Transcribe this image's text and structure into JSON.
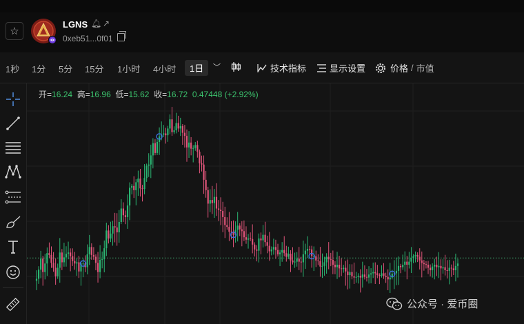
{
  "header": {
    "token_name": "LGNS",
    "address": "0xeb51...0f01",
    "favorite_icon": "star-icon",
    "bell_icon": "bell-icon",
    "external_icon": "external-link-icon",
    "copy_icon": "copy-icon"
  },
  "toolbar": {
    "timeframes": [
      "1秒",
      "1分",
      "5分",
      "15分",
      "1小时",
      "4小时"
    ],
    "active_timeframe": "1日",
    "chart_type_icon": "candlestick-icon",
    "indicators_label": "技术指标",
    "display_label": "显示设置",
    "price_label": "价格",
    "slash": "/",
    "marketcap_label": "市值"
  },
  "left_tools": [
    "crosshair-icon",
    "trend-line-icon",
    "horizontal-lines-icon",
    "pattern-icon",
    "fib-icon",
    "brush-icon",
    "text-icon",
    "emoji-icon",
    "ruler-icon"
  ],
  "ohlc": {
    "open_label": "开=",
    "open": "16.24",
    "high_label": "高=",
    "high": "16.96",
    "low_label": "低=",
    "low": "15.62",
    "close_label": "收=",
    "close": "16.72",
    "change": "0.47448 (+2.92%)"
  },
  "colors": {
    "up": "#2bb673",
    "down": "#e0557a",
    "background": "#141414"
  },
  "watermark": "公众号 · 爱币圈",
  "chart_data": {
    "type": "candlestick",
    "title": "",
    "close": [
      6.5,
      8,
      9.8,
      7.6,
      9,
      10.7,
      10.4,
      9.1,
      8.3,
      6.9,
      8.3,
      10.8,
      9.2,
      10,
      10.6,
      10.8,
      10.2,
      9.4,
      9,
      9.2,
      7.7,
      9,
      9,
      8.4,
      10.5,
      11.7,
      10.4,
      10.1,
      9.1,
      7.6,
      9.6,
      9.7,
      11.5,
      14.4,
      13.1,
      13.9,
      15.1,
      14.9,
      14.1,
      15.8,
      18,
      16.9,
      16.6,
      18.5,
      21.4,
      21.7,
      21,
      22.3,
      22.9,
      21.3,
      21.2,
      23,
      25,
      25.2,
      26.7,
      28.7,
      27.1,
      28.9,
      29.8,
      30.1,
      30.3,
      30,
      31.1,
      32.6,
      30.5,
      30.8,
      32,
      31.1,
      31.5,
      30.4,
      29.9,
      28,
      28.8,
      27.8,
      27.9,
      28.4,
      27.3,
      25.4,
      25.2,
      22.7,
      21,
      18.8,
      19.4,
      18.9,
      19.9,
      18,
      17.8,
      17.6,
      16.6,
      15.3,
      15,
      14.2,
      14.1,
      13.7,
      14.5,
      15.2,
      14.6,
      14.3,
      13.3,
      12.9,
      13.1,
      13,
      12.1,
      11.3,
      11.1,
      13.1,
      12.8,
      13.7,
      12.5,
      11.9,
      11,
      11.3,
      11.7,
      11.2,
      10.5,
      10.8,
      11.2,
      10.7,
      10.1,
      10.6,
      9.5,
      9.2,
      9.3,
      9.8,
      9.3,
      9.2,
      10.5,
      11.1,
      11.4,
      11.3,
      10.2,
      10.2,
      9.5,
      9.4,
      8.5,
      8.6,
      9.2,
      10.1,
      9.7,
      9.6,
      8.8,
      8.4,
      8.8,
      8.2,
      8.1,
      8.3,
      7.7,
      7.1,
      7.6,
      6.9,
      6.7,
      6.8,
      7,
      6.7,
      7.2,
      6.8,
      6.7,
      7.2,
      7.4,
      7.6,
      7.4,
      7.1,
      7,
      7.4,
      7,
      6.8,
      6.4,
      6.7,
      7.3,
      7.4,
      7.8,
      8.6,
      8.4,
      8.8,
      9.3,
      8.8,
      9.3,
      9.9,
      10.2,
      10.4,
      10.1,
      9.5,
      9.1,
      8.9,
      8.8,
      8.3,
      7.9,
      8.5,
      8.8,
      8.4,
      8.6,
      8.2,
      8.4,
      7.9,
      7.8,
      8.3,
      8.2,
      7.9,
      8.6,
      9
    ],
    "up_color": "#2bb673",
    "down_color": "#e0557a",
    "markers": [
      22,
      58,
      93,
      130,
      168
    ],
    "reference_line": 9.9,
    "grid": true
  }
}
